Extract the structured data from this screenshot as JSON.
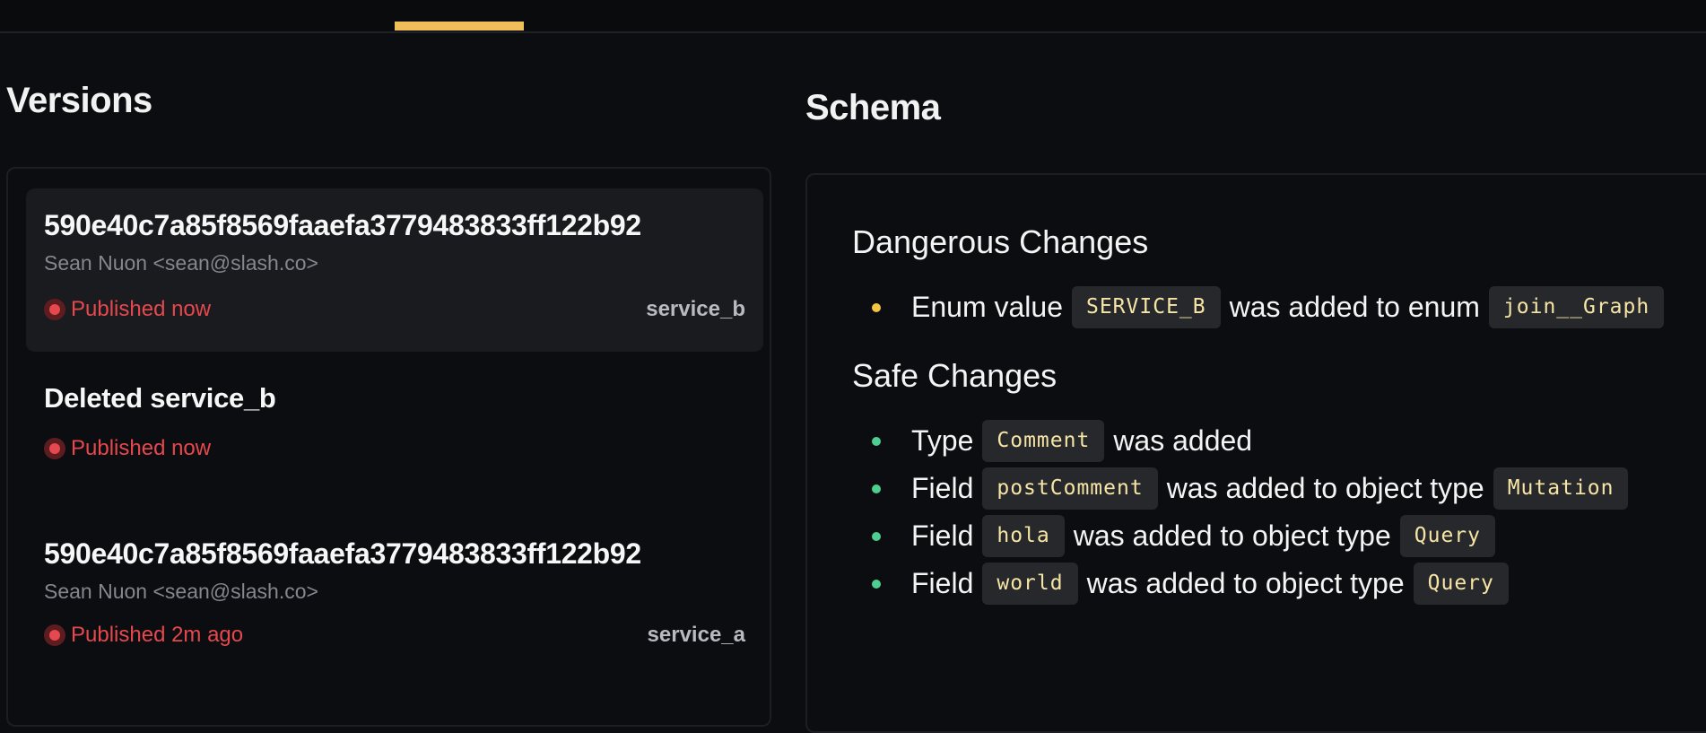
{
  "versions": {
    "title": "Versions",
    "items": [
      {
        "hash": "590e40c7a85f8569faaefa3779483833ff122b92",
        "author": "Sean Nuon <sean@slash.co>",
        "status": "Published now",
        "service": "service_b"
      },
      {
        "hash": "Deleted service_b",
        "author": "",
        "status": "Published now",
        "service": ""
      },
      {
        "hash": "590e40c7a85f8569faaefa3779483833ff122b92",
        "author": "Sean Nuon <sean@slash.co>",
        "status": "Published 2m ago",
        "service": "service_a"
      }
    ]
  },
  "schema": {
    "title": "Schema",
    "dangerous": {
      "heading": "Dangerous Changes",
      "items": [
        {
          "text1": "Enum value",
          "code1": "SERVICE_B",
          "text2": "was added to enum",
          "code2": "join__Graph"
        }
      ]
    },
    "safe": {
      "heading": "Safe Changes",
      "items": [
        {
          "text1": "Type",
          "code1": "Comment",
          "text2": "was added",
          "code2": ""
        },
        {
          "text1": "Field",
          "code1": "postComment",
          "text2": "was added to object type",
          "code2": "Mutation"
        },
        {
          "text1": "Field",
          "code1": "hola",
          "text2": "was added to object type",
          "code2": "Query"
        },
        {
          "text1": "Field",
          "code1": "world",
          "text2": "was added to object type",
          "code2": "Query"
        }
      ]
    }
  },
  "colors": {
    "accent": "#f0bf5a",
    "danger": "#e5484d",
    "warning": "#f4c542",
    "safe": "#4ccf8f"
  }
}
